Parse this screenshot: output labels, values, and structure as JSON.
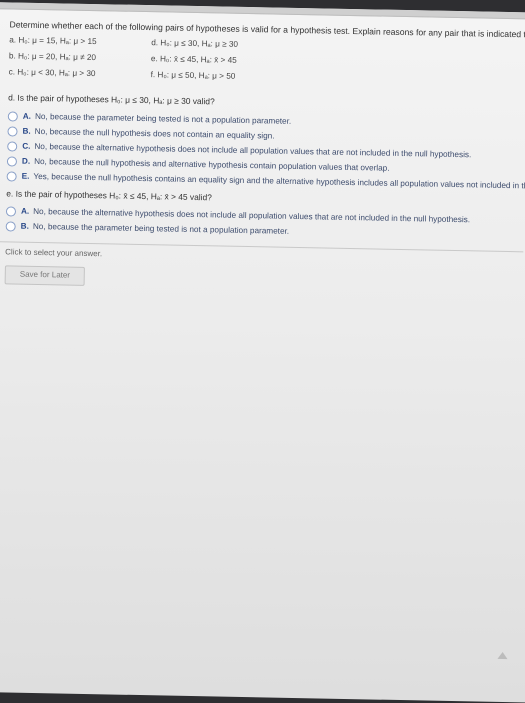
{
  "question": "Determine whether each of the following pairs of hypotheses is valid for a hypothesis test. Explain reasons for any pair that is indicated to be invalid.",
  "pairs": {
    "a": "a.  H₀: μ = 15, Hₐ: μ > 15",
    "b": "b.  H₀: μ = 20, Hₐ: μ ≠ 20",
    "c": "c.  H₀: μ < 30, Hₐ: μ > 30",
    "d": "d.  H₀: μ ≤ 30, Hₐ: μ ≥ 30",
    "e": "e.  H₀: x̄ ≤ 45, Hₐ: x̄ > 45",
    "f": "f.  H₀: μ ≤ 50, Hₐ: μ > 50"
  },
  "part_d": {
    "question": "d. Is the pair of hypotheses H₀: μ ≤ 30, Hₐ: μ ≥ 30 valid?",
    "options": [
      {
        "letter": "A.",
        "text": "No, because the parameter being tested is not a population parameter."
      },
      {
        "letter": "B.",
        "text": "No, because the null hypothesis does not contain an equality sign."
      },
      {
        "letter": "C.",
        "text": "No, because the alternative hypothesis does not include all population values that are not included in the null hypothesis."
      },
      {
        "letter": "D.",
        "text": "No, because the null hypothesis and alternative hypothesis contain population values that overlap."
      },
      {
        "letter": "E.",
        "text": "Yes, because the null hypothesis contains an equality sign and the alternative hypothesis includes all population values not included in the null hypothesis."
      }
    ]
  },
  "part_e": {
    "question": "e. Is the pair of hypotheses H₀: x̄ ≤ 45, Hₐ: x̄ > 45 valid?",
    "options": [
      {
        "letter": "A.",
        "text": "No, because the alternative hypothesis does not include all population values that are not included in the null hypothesis."
      },
      {
        "letter": "B.",
        "text": "No, because the parameter being tested is not a population parameter."
      }
    ]
  },
  "footer": {
    "hint": "Click to select your answer.",
    "save_label": "Save for Later"
  }
}
